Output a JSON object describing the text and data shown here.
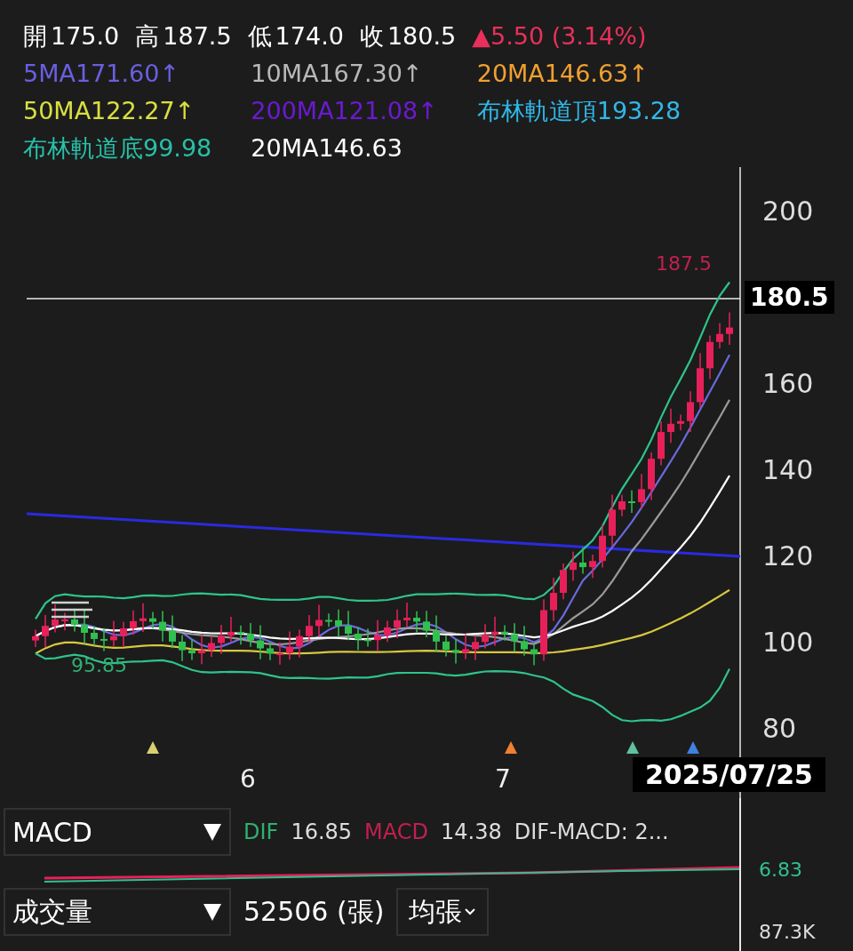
{
  "quote": [
    {
      "label": "開",
      "value": "175.0"
    },
    {
      "label": "高",
      "value": "187.5"
    },
    {
      "label": "低",
      "value": "174.0"
    },
    {
      "label": "收",
      "value": "180.5"
    }
  ],
  "change": "▲5.50 (3.14%)",
  "ma_legend": [
    {
      "text": "5MA171.60↑",
      "color": "#6a5fe0"
    },
    {
      "text": "10MA167.30↑",
      "color": "#b8b8b8"
    },
    {
      "text": "20MA146.63↑",
      "color": "#f0a030"
    },
    {
      "text": "50MA122.27↑",
      "color": "#d8e040"
    },
    {
      "text": "200MA121.08↑",
      "color": "#6a1ad0"
    },
    {
      "text": "布林軌道頂193.28",
      "color": "#30b8e8"
    },
    {
      "text": "布林軌道底99.98",
      "color": "#28c0a8"
    },
    {
      "text": "20MA146.63",
      "color": "#ffffff"
    }
  ],
  "price_axis": [
    "200",
    "160",
    "140",
    "120",
    "100",
    "80"
  ],
  "last_price": "180.5",
  "high_label": "187.5",
  "low_label": "95.85",
  "x_axis": [
    "6",
    "7"
  ],
  "date": "2025/07/25",
  "macd": {
    "selector": "MACD",
    "dif_label": "DIF",
    "dif": "16.85",
    "macd_label": "MACD",
    "macd_value": "14.38",
    "diff": "DIF-MACD: 2...",
    "axis_value": "6.83"
  },
  "volume": {
    "selector": "成交量",
    "value": "52506 (張)",
    "unit_button": "均張",
    "axis_value": "87.3K"
  }
}
